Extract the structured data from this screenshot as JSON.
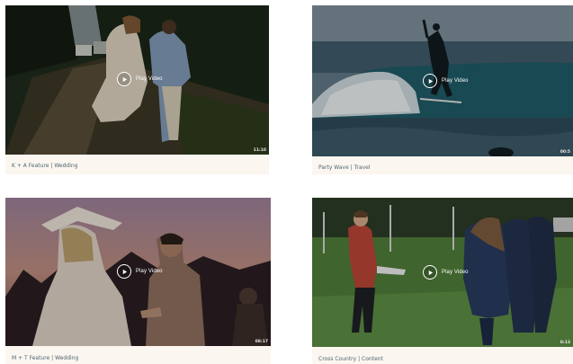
{
  "play_label": "Play Video",
  "videos": [
    {
      "title": "K + A Feature",
      "category": "Wedding",
      "separator": " | ",
      "duration": "11:10",
      "scene": "wedding-couple-walking"
    },
    {
      "title": "Party Wave",
      "category": "Travel",
      "separator": " | ",
      "duration": "00:5",
      "scene": "surfer-on-wave"
    },
    {
      "title": "M + T Feature",
      "category": "Wedding",
      "separator": " | ",
      "duration": "08:17",
      "scene": "couple-at-dusk"
    },
    {
      "title": "Cross Country",
      "category": "Content",
      "separator": " | ",
      "duration": "0:13",
      "scene": "school-cross-country"
    }
  ],
  "colors": {
    "card_bg": "#fbf6ef",
    "caption_text": "#4e6675",
    "overlay_text": "#ffffff"
  },
  "icons": {
    "play": "play-circle-icon"
  }
}
